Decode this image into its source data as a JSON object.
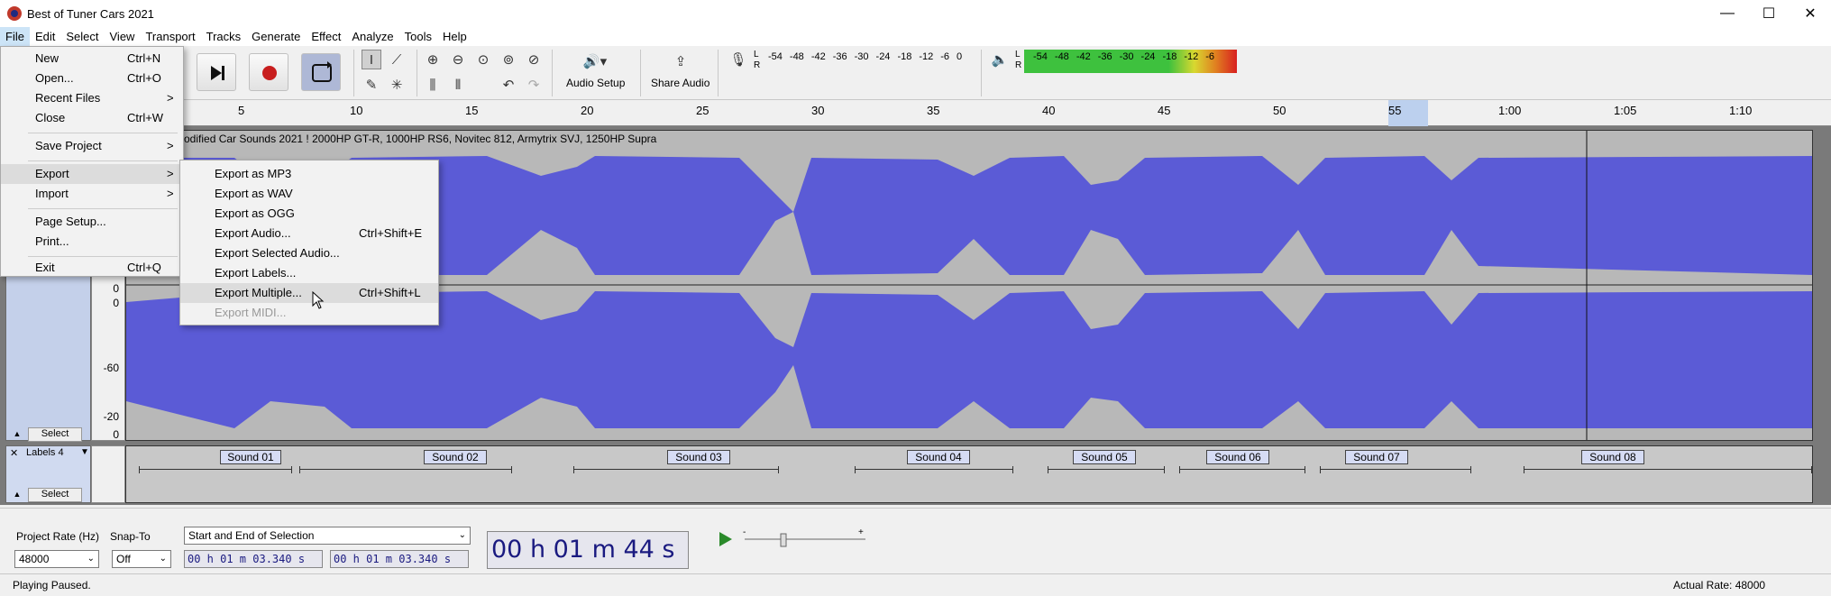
{
  "window": {
    "title": "Best of Tuner Cars 2021",
    "minimize": "—",
    "maximize": "☐",
    "close": "✕"
  },
  "menubar": [
    "File",
    "Edit",
    "Select",
    "View",
    "Transport",
    "Tracks",
    "Generate",
    "Effect",
    "Analyze",
    "Tools",
    "Help"
  ],
  "toolbar": {
    "audio_setup": "Audio Setup",
    "share_audio": "Share Audio",
    "rec_meter_ticks": [
      "-54",
      "-48",
      "-42",
      "-36",
      "-30",
      "-24",
      "-18",
      "-12",
      "-6",
      "0"
    ],
    "play_meter_ticks": [
      "-54",
      "-48",
      "-42",
      "-36",
      "-30",
      "-24",
      "-18",
      "-12",
      "-6"
    ],
    "lr_left": "L",
    "lr_right": "R"
  },
  "ruler": {
    "labels": [
      "5",
      "10",
      "15",
      "20",
      "25",
      "30",
      "35",
      "40",
      "45",
      "50",
      "55",
      "1:00",
      "1:05",
      "1:10"
    ]
  },
  "audio_track": {
    "clip_name": "odified Car Sounds 2021 ! 2000HP GT-R, 1000HP RS6, Novitec 812, Armytrix SVJ, 1250HP Supra",
    "vr_labels": [
      "0",
      "0",
      "-60",
      "-20",
      "0"
    ],
    "select_label": "Select",
    "wave_color": "#5b5bd6"
  },
  "label_track": {
    "name": "Labels 4",
    "select_label": "Select",
    "labels": [
      "Sound 01",
      "Sound 02",
      "Sound 03",
      "Sound 04",
      "Sound 05",
      "Sound 06",
      "Sound 07",
      "Sound 08"
    ]
  },
  "file_menu": {
    "items": [
      {
        "label": "New",
        "shortcut": "Ctrl+N",
        "arrow": ""
      },
      {
        "label": "Open...",
        "shortcut": "Ctrl+O",
        "arrow": ""
      },
      {
        "label": "Recent Files",
        "shortcut": "",
        "arrow": ">"
      },
      {
        "label": "Close",
        "shortcut": "Ctrl+W",
        "arrow": ""
      },
      {
        "label": "Save Project",
        "shortcut": "",
        "arrow": ">"
      },
      {
        "label": "Export",
        "shortcut": "",
        "arrow": ">"
      },
      {
        "label": "Import",
        "shortcut": "",
        "arrow": ">"
      },
      {
        "label": "Page Setup...",
        "shortcut": "",
        "arrow": ""
      },
      {
        "label": "Print...",
        "shortcut": "",
        "arrow": ""
      },
      {
        "label": "Exit",
        "shortcut": "Ctrl+Q",
        "arrow": ""
      }
    ]
  },
  "export_menu": {
    "items": [
      {
        "label": "Export as MP3",
        "shortcut": ""
      },
      {
        "label": "Export as WAV",
        "shortcut": ""
      },
      {
        "label": "Export as OGG",
        "shortcut": ""
      },
      {
        "label": "Export Audio...",
        "shortcut": "Ctrl+Shift+E"
      },
      {
        "label": "Export Selected Audio...",
        "shortcut": ""
      },
      {
        "label": "Export Labels...",
        "shortcut": ""
      },
      {
        "label": "Export Multiple...",
        "shortcut": "Ctrl+Shift+L"
      },
      {
        "label": "Export MIDI...",
        "shortcut": ""
      }
    ]
  },
  "selection_toolbar": {
    "project_rate_label": "Project Rate (Hz)",
    "project_rate_value": "48000",
    "snap_to_label": "Snap-To",
    "snap_to_value": "Off",
    "selection_mode": "Start and End of Selection",
    "sel_start": "00 h 01 m 03.340 s",
    "sel_end": "00 h 01 m 03.340 s",
    "position": "00 h 01 m 44 s"
  },
  "status": {
    "left": "Playing Paused.",
    "right": "Actual Rate: 48000"
  }
}
